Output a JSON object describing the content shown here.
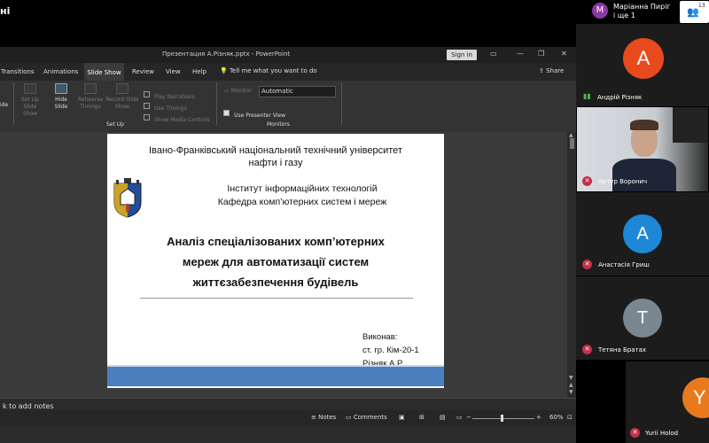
{
  "meeting": {
    "title": "ні"
  },
  "presenter": {
    "initial": "М",
    "name_line1": "Маріанна Пиріг",
    "name_line2": "і ще 1"
  },
  "participants_count": "13",
  "ppt": {
    "window_title": "Презентация А.Різняк.pptx - PowerPoint",
    "signin": "Sign in",
    "tabs": [
      "Transitions",
      "Animations",
      "Slide Show",
      "Review",
      "View",
      "Help"
    ],
    "tellme": "Tell me what you want to do",
    "share": "Share",
    "ribbon": {
      "partial_left": "ide",
      "setup_show": "Set Up\nSlide Show",
      "hide_slide": "Hide\nSlide",
      "rehearse": "Rehearse\nTimings",
      "record": "Record Slide\nShow",
      "play_narrations": "Play Narrations",
      "use_timings": "Use Timings",
      "show_media": "Show Media Controls",
      "group_setup": "Set Up",
      "monitor_label": "Monitor:",
      "monitor_value": "Automatic",
      "presenter_view": "Use Presenter View",
      "group_monitors": "Monitors"
    },
    "notes_prompt": "k to add notes",
    "status": {
      "notes": "Notes",
      "comments": "Comments",
      "zoom": "60%"
    }
  },
  "slide": {
    "university_line1": "Івано-Франківський національний технічний університет",
    "university_line2": "нафти і газу",
    "institute": "Інститут інформаційних технологій",
    "department": "Кафедра комп’ютерних систем і мереж",
    "title_line1": "Аналіз спеціалізованих комп’ютерних",
    "title_line2": "мереж для автоматизації систем",
    "title_line3": "життєзабезпечення будівель",
    "done_by": "Виконав:",
    "group": "ст. гр. Кім-20-1",
    "author": "Різняк А.Р."
  },
  "participants": [
    {
      "initial": "А",
      "name": "Андрій Різняк",
      "color": "#e8491d"
    },
    {
      "name": "Артур Воронич"
    },
    {
      "initial": "А",
      "name": "Анастасія Гриш",
      "color": "#1e88d6"
    },
    {
      "initial": "Т",
      "name": "Тетяна Братах",
      "color": "#7a8790"
    },
    {
      "initial": "Y",
      "name": "Yurii Holod",
      "color": "#e87a1d"
    }
  ]
}
